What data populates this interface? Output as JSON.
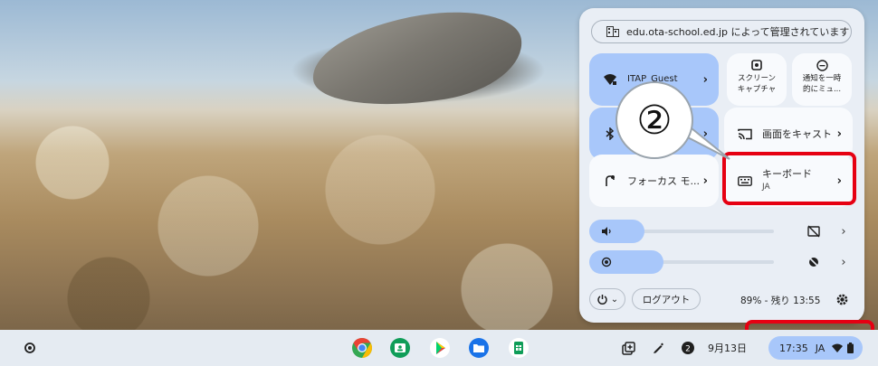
{
  "quick_settings": {
    "managed_text": "edu.ota-school.ed.jp によって管理されています",
    "network": {
      "label": "ITAP_Guest",
      "sub": ""
    },
    "bluetooth": {
      "label": ""
    },
    "screen_capture": {
      "line1": "スクリーン",
      "line2": "キャプチャ"
    },
    "notifications": {
      "line1": "通知を一時",
      "line2": "的にミュ..."
    },
    "cast": {
      "label": "画面をキャスト"
    },
    "focus": {
      "label": "フォーカス モ..."
    },
    "keyboard": {
      "label": "キーボード",
      "sub": "JA"
    },
    "chevron": "›",
    "volume_level": 0.3,
    "brightness_level": 0.4,
    "power_chevron": "⌄",
    "signout_label": "ログアウト",
    "battery_text": "89% - 残り 13:55"
  },
  "callout": {
    "number": "②"
  },
  "shelf": {
    "apps": [
      "chrome-icon",
      "classroom-icon",
      "play-store-icon",
      "files-icon",
      "sheets-icon"
    ],
    "date": "9月13日",
    "time": "17:35",
    "ime": "JA"
  },
  "colors": {
    "accent": "#a8c7fa",
    "highlight": "#e60012",
    "panel": "#e9eef5"
  }
}
